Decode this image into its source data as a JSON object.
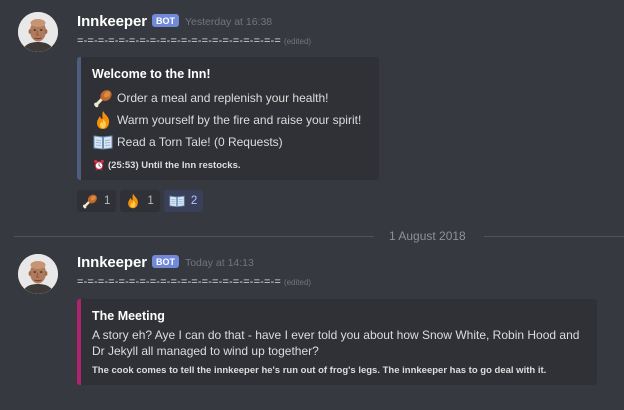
{
  "colors": {
    "background": "#36393f",
    "embed_background": "#2f3136",
    "bot_tag": "#7289da",
    "embed1_border": "#4f5d7e",
    "embed2_border": "#b0246f",
    "reaction_me_background": "#3b405a"
  },
  "messages": [
    {
      "author": "Innkeeper",
      "bot_tag": "BOT",
      "timestamp": "Yesterday at 16:38",
      "content": "=-=-=-=-=-=-=-=-=-=-=-=-=-=-=-=-=-=-=-=",
      "edited": "(edited)",
      "embed": {
        "title": "Welcome to the Inn!",
        "lines": [
          {
            "icon": "meat-on-bone-icon",
            "text": "Order a meal and replenish your health!"
          },
          {
            "icon": "fire-icon",
            "text": "Warm yourself by the fire and raise your spirit!"
          },
          {
            "icon": "open-book-icon",
            "text": "Read a Torn Tale! (0 Requests)"
          }
        ],
        "footer": {
          "icon": "alarm-clock-icon",
          "text": "(25:53) Until the Inn restocks."
        }
      },
      "reactions": [
        {
          "icon": "meat-on-bone-icon",
          "count": "1",
          "me": false
        },
        {
          "icon": "fire-icon",
          "count": "1",
          "me": false
        },
        {
          "icon": "open-book-icon",
          "count": "2",
          "me": true
        }
      ]
    },
    {
      "author": "Innkeeper",
      "bot_tag": "BOT",
      "timestamp": "Today at 14:13",
      "content": "=-=-=-=-=-=-=-=-=-=-=-=-=-=-=-=-=-=-=-=",
      "edited": "(edited)",
      "embed": {
        "title": "The Meeting",
        "body": "A story eh? Aye I can do that - have I ever told you about how Snow White, Robin Hood and Dr Jekyll all managed to wind up together?",
        "footer": "The cook comes to tell the innkeeper he's run out of frog's legs. The innkeeper has to go deal with it."
      }
    }
  ],
  "date_divider": "1 August 2018"
}
